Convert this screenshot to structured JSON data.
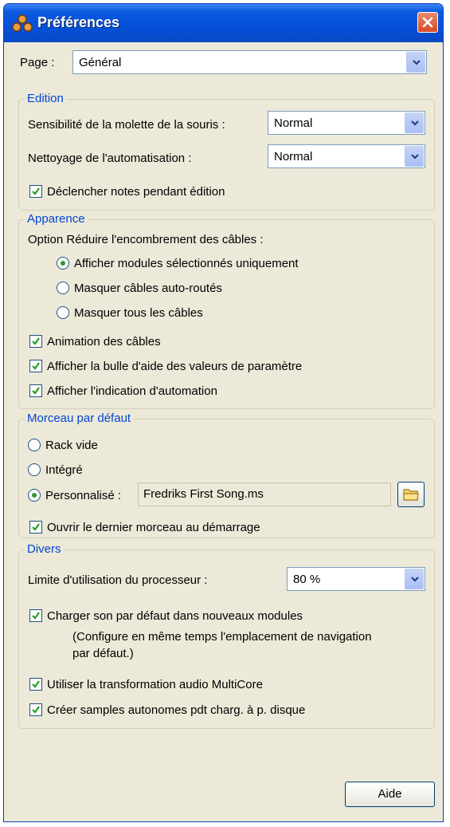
{
  "window": {
    "title": "Préférences"
  },
  "page": {
    "label": "Page :",
    "value": "Général"
  },
  "edition": {
    "title": "Edition",
    "wheel_label": "Sensibilité de la molette de la souris :",
    "wheel_value": "Normal",
    "cleanup_label": "Nettoyage de l'automatisation :",
    "cleanup_value": "Normal",
    "trigger_notes": {
      "label": "Déclencher notes pendant édition",
      "checked": true
    }
  },
  "appearance": {
    "title": "Apparence",
    "reduce_label": "Option Réduire l'encombrement des câbles :",
    "options": [
      {
        "label": "Afficher modules sélectionnés uniquement",
        "selected": true
      },
      {
        "label": "Masquer câbles auto-routés",
        "selected": false
      },
      {
        "label": "Masquer tous les câbles",
        "selected": false
      }
    ],
    "checkboxes": [
      {
        "label": "Animation des câbles",
        "checked": true
      },
      {
        "label": "Afficher la bulle d'aide des valeurs de paramètre",
        "checked": true
      },
      {
        "label": "Afficher l'indication d'automation",
        "checked": true
      }
    ]
  },
  "default_song": {
    "title": "Morceau par défaut",
    "options": [
      {
        "label": "Rack vide",
        "selected": false
      },
      {
        "label": "Intégré",
        "selected": false
      },
      {
        "label": "Personnalisé :",
        "selected": true
      }
    ],
    "custom_path": "Fredriks First Song.ms",
    "open_last": {
      "label": "Ouvrir le dernier morceau au démarrage",
      "checked": true
    }
  },
  "misc": {
    "title": "Divers",
    "cpu_label": "Limite d'utilisation du processeur :",
    "cpu_value": "80 %",
    "load_sound": {
      "label": "Charger son par défaut dans nouveaux modules",
      "checked": true
    },
    "load_sound_note_1": "(Configure en même temps l'emplacement de navigation",
    "load_sound_note_2": "par défaut.)",
    "multicore": {
      "label": "Utiliser la transformation audio MultiCore",
      "checked": true
    },
    "samples": {
      "label": "Créer samples autonomes pdt charg. à  p. disque",
      "checked": true
    }
  },
  "footer": {
    "help_label": "Aide"
  },
  "colors": {
    "titlebar": "#0a5ae0",
    "group_title": "#0046d5",
    "window_bg": "#ece9d8",
    "close": "#d64b26"
  }
}
